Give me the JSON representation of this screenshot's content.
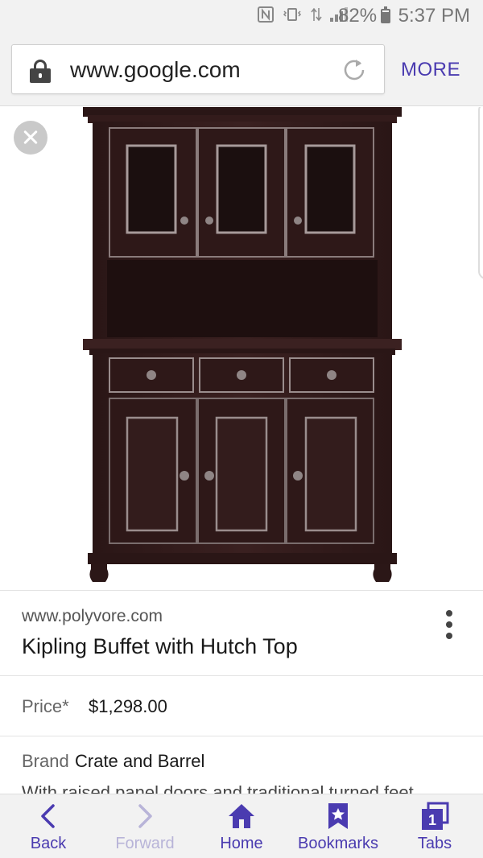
{
  "status_bar": {
    "battery": "82%",
    "time": "5:37 PM"
  },
  "address_bar": {
    "url": "www.google.com",
    "more_label": "MORE"
  },
  "result": {
    "source": "www.polyvore.com",
    "title": "Kipling Buffet with Hutch Top",
    "price_label": "Price*",
    "price_value": "$1,298.00",
    "brand_label": "Brand",
    "brand_value": "Crate and Barrel",
    "description": "With raised panel doors and traditional turned feet"
  },
  "bottom_nav": {
    "back": "Back",
    "forward": "Forward",
    "home": "Home",
    "bookmarks": "Bookmarks",
    "tabs": "Tabs",
    "tabs_count": "1"
  },
  "colors": {
    "accent": "#4a3bb0",
    "cabinet_wood": "#2e1a1a"
  }
}
